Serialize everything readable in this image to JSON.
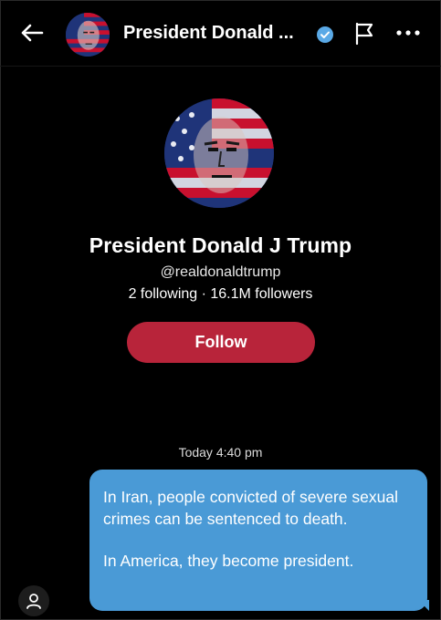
{
  "header": {
    "title": "President Donald ...",
    "back_icon": "arrow-left-icon",
    "verified_icon": "verified-badge-icon",
    "flag_icon": "flag-icon",
    "more_icon": "more-horizontal-icon"
  },
  "profile": {
    "name": "President Donald J Trump",
    "handle": "@realdonaldtrump",
    "stats": "2 following · 16.1M followers",
    "follow_label": "Follow"
  },
  "chat": {
    "timestamp": "Today 4:40 pm",
    "message_line1": "In Iran, people convicted of severe sexual crimes can be sentenced to death.",
    "message_line2": "In America, they become president."
  },
  "footer": {
    "user_icon": "user-icon"
  },
  "colors": {
    "background": "#000000",
    "follow_button": "#b8243a",
    "bubble": "#4a9ad6",
    "verified": "#5aa9e6"
  }
}
